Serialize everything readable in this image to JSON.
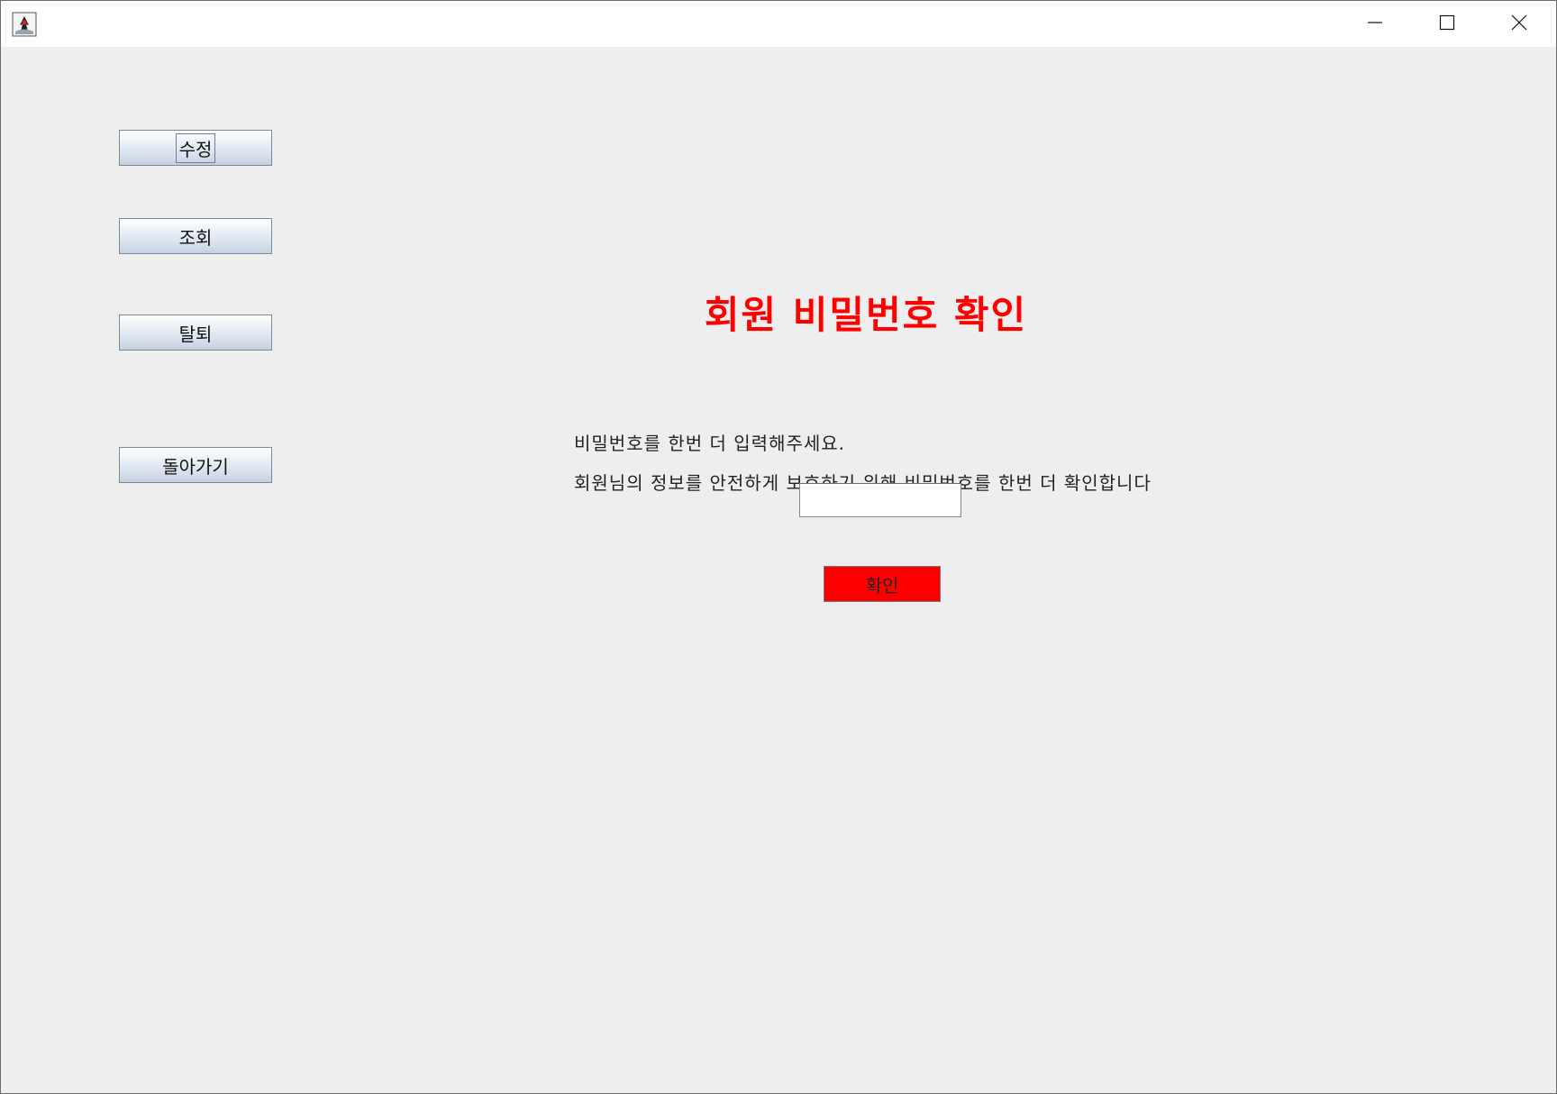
{
  "window": {
    "app_icon": "java-duke-icon",
    "controls": {
      "minimize": "minimize-icon",
      "maximize": "maximize-icon",
      "close": "close-icon"
    }
  },
  "sidebar": {
    "buttons": [
      {
        "label": "수정"
      },
      {
        "label": "조회"
      },
      {
        "label": "탈퇴"
      },
      {
        "label": "돌아가기"
      }
    ]
  },
  "main": {
    "title": "회원 비밀번호 확인",
    "message1": "비밀번호를 한번 더 입력해주세요.",
    "message2": "회원님의 정보를 안전하게 보호하기 위해 비밀번호를 한번 더 확인합니다",
    "password_value": "",
    "confirm_label": "확인"
  },
  "colors": {
    "accent": "#ff0000",
    "background": "#eeeeee"
  }
}
